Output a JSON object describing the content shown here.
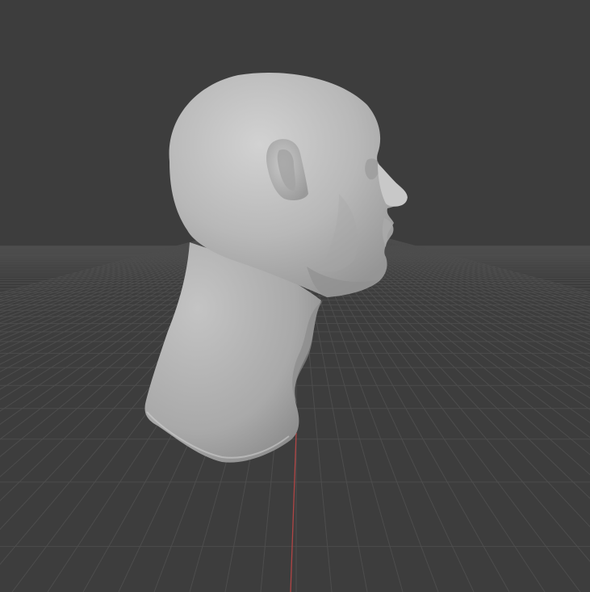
{
  "viewport": {
    "background_color": "#3d3d3d",
    "grid_line_color": "#4d4d4d",
    "x_axis_color": "#b04545",
    "model": {
      "name": "head-sculpt",
      "color": "#bdbdbd",
      "view": "right-side-profile"
    }
  }
}
